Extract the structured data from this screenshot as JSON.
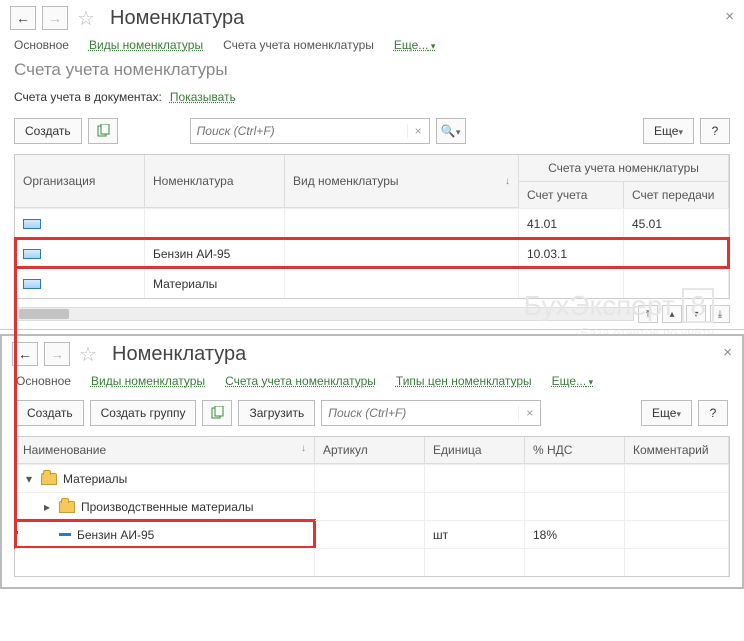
{
  "top": {
    "title": "Номенклатура",
    "tabs": {
      "main": "Основное",
      "types": "Виды номенклатуры",
      "accounts": "Счета учета номенклатуры",
      "more": "Еще..."
    },
    "section": "Счета учета номенклатуры",
    "docLabel": "Счета учета в документах:",
    "docValue": "Показывать",
    "create": "Создать",
    "searchPlaceholder": "Поиск (Ctrl+F)",
    "moreBtn": "Еще",
    "help": "?",
    "columns": {
      "org": "Организация",
      "nom": "Номенклатура",
      "vid": "Вид номенклатуры",
      "accGroup": "Счета учета номенклатуры",
      "acc1": "Счет учета",
      "acc2": "Счет передачи"
    },
    "rows": [
      {
        "nom": "",
        "acc1": "41.01",
        "acc2": "45.01"
      },
      {
        "nom": "Бензин АИ-95",
        "acc1": "10.03.1",
        "acc2": ""
      },
      {
        "nom": "Материалы",
        "acc1": "",
        "acc2": ""
      }
    ]
  },
  "bottom": {
    "title": "Номенклатура",
    "tabs": {
      "main": "Основное",
      "types": "Виды номенклатуры",
      "accounts": "Счета учета номенклатуры",
      "price": "Типы цен номенклатуры",
      "more": "Еще..."
    },
    "create": "Создать",
    "createGroup": "Создать группу",
    "load": "Загрузить",
    "searchPlaceholder": "Поиск (Ctrl+F)",
    "moreBtn": "Еще",
    "help": "?",
    "columns": {
      "name": "Наименование",
      "art": "Артикул",
      "unit": "Единица",
      "nds": "% НДС",
      "com": "Комментарий"
    },
    "rows": [
      {
        "indent": 1,
        "type": "folder",
        "expand": "▾",
        "name": "Материалы"
      },
      {
        "indent": 2,
        "type": "folder",
        "expand": "▸",
        "name": "Производственные материалы"
      },
      {
        "indent": 2,
        "type": "item",
        "name": "Бензин АИ-95",
        "unit": "шт",
        "nds": "18%"
      }
    ]
  }
}
